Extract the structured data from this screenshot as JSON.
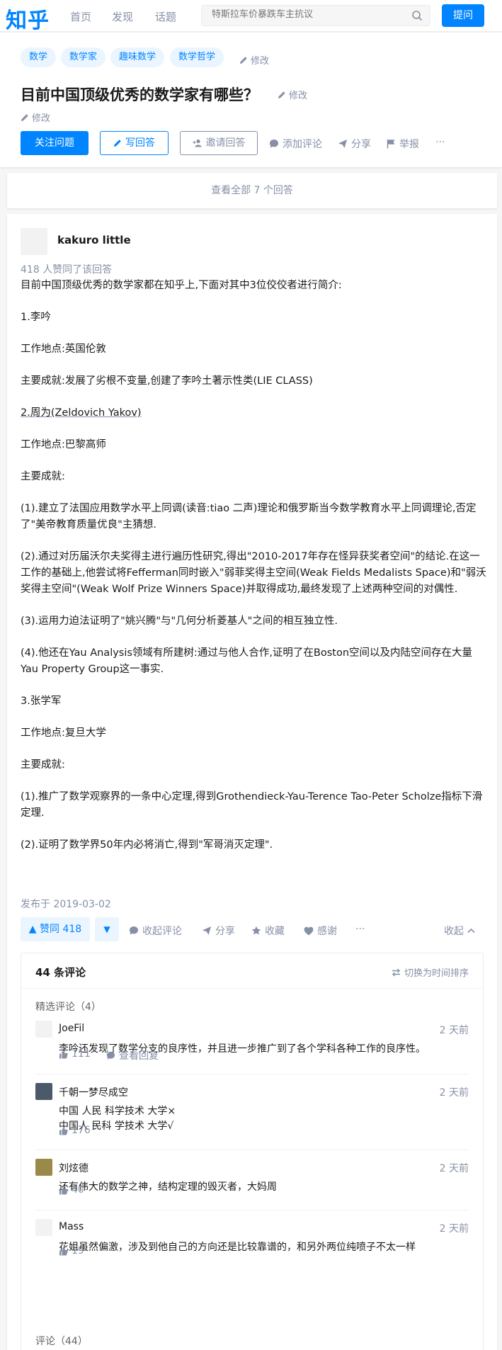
{
  "brand": {
    "logo": "知乎",
    "accent": "#0084ff"
  },
  "nav": {
    "home": "首页",
    "explore": "发现",
    "topics": "话题"
  },
  "search": {
    "placeholder": "特斯拉车价暴跌车主抗议"
  },
  "header": {
    "ask_label": "提问"
  },
  "question": {
    "tags": [
      "数学",
      "数学家",
      "趣味数学",
      "数学哲学"
    ],
    "tags_edit": "修改",
    "title": "目前中国顶级优秀的数学家有哪些？",
    "title_edit": "修改",
    "desc_edit": "修改",
    "follow_label": "关注问题",
    "write_label": "写回答",
    "invite_label": "邀请回答",
    "comment_label": "添加评论",
    "share_label": "分享",
    "report_label": "举报",
    "more_label": "···"
  },
  "view_all": "查看全部 7 个回答",
  "answer": {
    "author": "kakuro little",
    "votes_text": "418 人赞同了该回答",
    "paragraphs": [
      "目前中国顶级优秀的数学家都在知乎上,下面对其中3位佼佼者进行简介:",
      "1.李吟",
      "工作地点:英国伦敦",
      "主要成就:发展了劣根不变量,创建了李吟土著示性类(LIE CLASS)",
      "2.周为(Zeldovich Yakov)",
      "工作地点:巴黎高师",
      "主要成就:",
      "(1).建立了法国应用数学水平上同调(读音:tiao 二声)理论和俄罗斯当今数学教育水平上同调理论,否定了\"美帝教育质量优良\"主猜想.",
      "(2).通过对历届沃尔夫奖得主进行遍历性研究,得出\"2010-2017年存在怪异获奖者空间\"的结论.在这一工作的基础上,他尝试将Fefferman同时嵌入\"弱菲奖得主空间(Weak Fields Medalists Space)和\"弱沃奖得主空间\"(Weak Wolf Prize Winners Space)并取得成功,最终发现了上述两种空间的对偶性.",
      "(3).运用力迫法证明了\"姚兴腾\"与\"几何分析菱基人\"之间的相互独立性.",
      "(4).他还在Yau Analysis领域有所建树:通过与他人合作,证明了在Boston空间以及内陆空间存在大量Yau Property Group这一事实.",
      "3.张学军",
      "工作地点:复旦大学",
      "主要成就:",
      "(1).推广了数学观察界的一条中心定理,得到Grothendieck-Yau-Terence Tao-Peter Scholze指标下滑定理.",
      "(2).证明了数学界50年内必将消亡,得到\"军哥消灭定理\"."
    ],
    "date": "发布于 2019-03-02",
    "vote_label": "▲ 赞同 418",
    "vote_down": "▼",
    "collapse_comments": "收起评论",
    "share": "分享",
    "favorite": "收藏",
    "thanks": "感谢",
    "more": "···",
    "collapse": "收起"
  },
  "comments": {
    "count_label": "44 条评论",
    "switch_label": "切换为时间排序",
    "featured_label": "精选评论（4）",
    "all_label": "评论（44）",
    "items": [
      {
        "author": "JoeFil",
        "time": "2 天前",
        "text": "李吟还发现了数学分支的良序性，并且进一步推广到了各个学科各种工作的良序性。",
        "likes": "111",
        "reply": "查看回复"
      },
      {
        "author": "千朝一梦尽成空",
        "time": "2 天前",
        "text": "中国 人民 科学技术 大学×\n中国人 民科 学技术 大学√",
        "likes": "176"
      },
      {
        "author": "刘炫德",
        "time": "2 天前",
        "text": "还有伟大的数学之神，结构定理的毁灭者，大妈周",
        "likes": "40"
      },
      {
        "author": "Mass",
        "time": "2 天前",
        "text": "花姐虽然偏激，涉及到他自己的方向还是比较靠谱的，和另外两位纯喷子不太一样",
        "likes": "19"
      }
    ]
  }
}
